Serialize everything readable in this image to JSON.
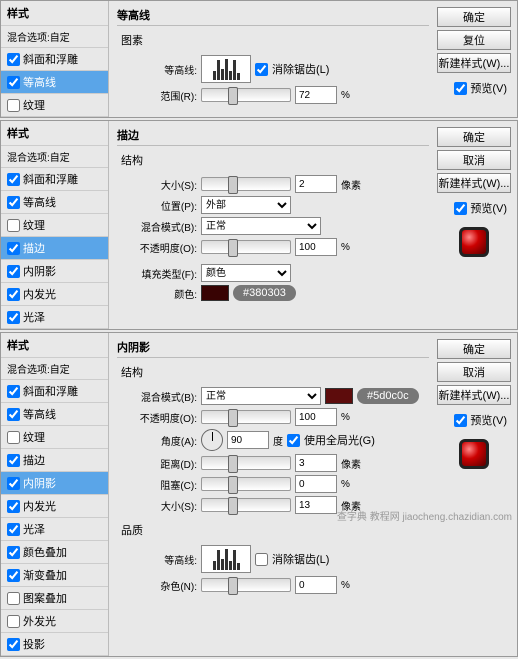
{
  "common": {
    "styles_header": "样式",
    "blend_opts": "混合选项:自定",
    "ok": "确定",
    "reset": "复位",
    "cancel": "取消",
    "new_style": "新建样式(W)...",
    "preview": "预览(V)"
  },
  "items": {
    "bevel": "斜面和浮雕",
    "contour": "等高线",
    "texture": "纹理",
    "stroke": "描边",
    "inner_shadow": "内阴影",
    "inner_glow": "内发光",
    "satin": "光泽",
    "color_overlay": "颜色叠加",
    "gradient_overlay": "渐变叠加",
    "pattern_overlay": "图案叠加",
    "outer_glow": "外发光",
    "drop_shadow": "投影"
  },
  "panel1": {
    "title": "等高线",
    "elements": "图素",
    "contour_lbl": "等高线:",
    "anti_alias": "消除锯齿(L)",
    "range_lbl": "范围(R):",
    "range_val": "72",
    "pct": "%"
  },
  "panel2": {
    "title": "描边",
    "structure": "结构",
    "size_lbl": "大小(S):",
    "size_val": "2",
    "px": "像素",
    "position_lbl": "位置(P):",
    "position_val": "外部",
    "blend_lbl": "混合模式(B):",
    "blend_val": "正常",
    "opacity_lbl": "不透明度(O):",
    "opacity_val": "100",
    "pct": "%",
    "fill_type_lbl": "填充类型(F):",
    "fill_type_val": "颜色",
    "color_lbl": "颜色:",
    "color_hex": "#380303"
  },
  "panel3": {
    "title": "内阴影",
    "structure": "结构",
    "blend_lbl": "混合模式(B):",
    "blend_val": "正常",
    "color_hex": "#5d0c0c",
    "opacity_lbl": "不透明度(O):",
    "opacity_val": "100",
    "pct": "%",
    "angle_lbl": "角度(A):",
    "angle_val": "90",
    "deg": "度",
    "global_light": "使用全局光(G)",
    "distance_lbl": "距离(D):",
    "distance_val": "3",
    "px": "像素",
    "choke_lbl": "阻塞(C):",
    "choke_val": "0",
    "size_lbl": "大小(S):",
    "size_val": "13",
    "quality": "品质",
    "contour_lbl": "等高线:",
    "anti_alias": "消除锯齿(L)",
    "noise_lbl": "杂色(N):",
    "noise_val": "0"
  },
  "watermark": "查字典 教程网 jiaocheng.chazidian.com"
}
